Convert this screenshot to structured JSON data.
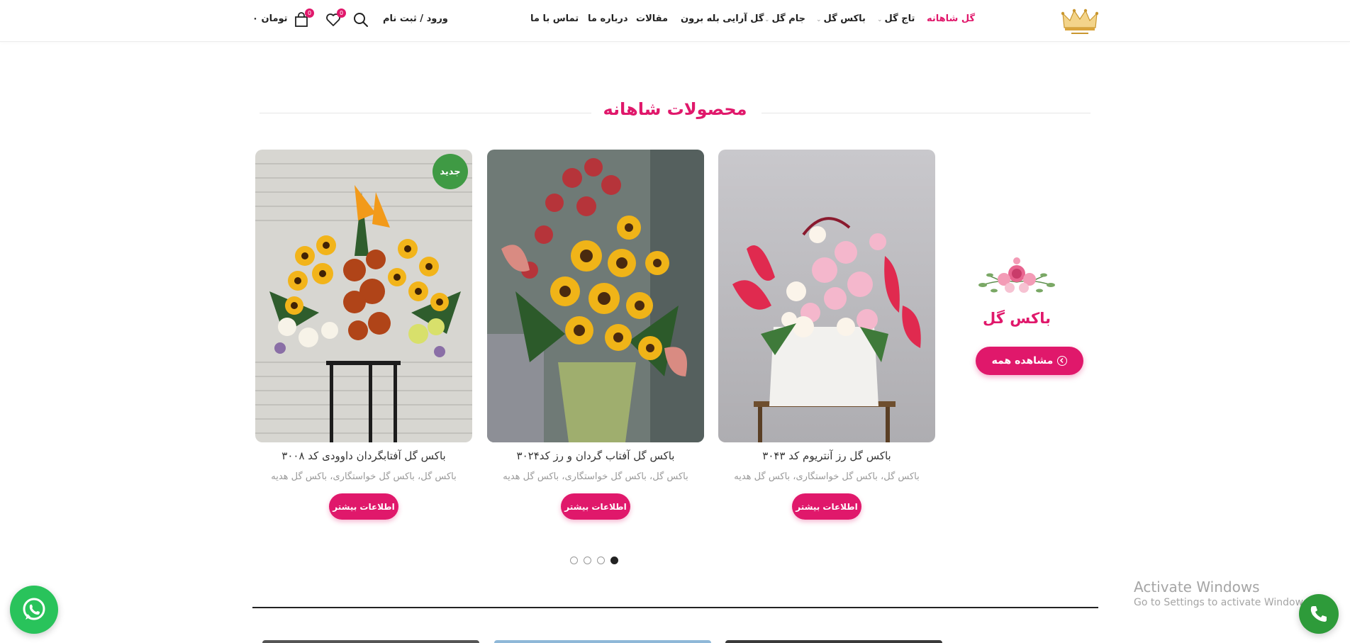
{
  "header": {
    "nav": [
      {
        "label": "گل شاهانه",
        "active": true,
        "dropdown": false
      },
      {
        "label": "تاج گل",
        "active": false,
        "dropdown": true
      },
      {
        "label": "باکس گل",
        "active": false,
        "dropdown": true
      },
      {
        "label": "جام گل",
        "active": false,
        "dropdown": true
      },
      {
        "label": "گل آرایی بله برون",
        "active": false,
        "dropdown": false
      },
      {
        "label": "مقالات",
        "active": false,
        "dropdown": false
      },
      {
        "label": "درباره ما",
        "active": false,
        "dropdown": false
      },
      {
        "label": "تماس با ما",
        "active": false,
        "dropdown": false
      }
    ],
    "login_label": "ورود / ثبت نام",
    "wishlist_count": "0",
    "cart_count": "0",
    "cart_total": "۰ تومان",
    "icons": {
      "search": "search-icon",
      "wishlist": "heart-icon",
      "cart": "shopping-bag-icon"
    }
  },
  "section": {
    "title": "محصولات شاهانه"
  },
  "promo": {
    "title": "باکس گل",
    "button_label": "مشاهده همه"
  },
  "products": [
    {
      "name": "باکس گل رز آنتریوم کد ۳۰۴۳",
      "categories": "باکس گل، باکس گل خواستگاری، باکس گل هدیه",
      "button_label": "اطلاعات بیشتر",
      "badge": ""
    },
    {
      "name": "باکس گل آفتاب گردان و رز کد۳۰۲۴",
      "categories": "باکس گل، باکس گل خواستگاری، باکس گل هدیه",
      "button_label": "اطلاعات بیشتر",
      "badge": ""
    },
    {
      "name": "باکس گل آفتابگردان داوودی کد ۳۰۰۸",
      "categories": "باکس گل، باکس گل خواستگاری، باکس گل هدیه",
      "button_label": "اطلاعات بیشتر",
      "badge": "جدید"
    }
  ],
  "carousel": {
    "page_count": 4,
    "active_page": 1
  },
  "watermark": {
    "line1": "Activate Windows",
    "line2": "Go to Settings to activate Windows."
  },
  "colors": {
    "accent": "#e0186b",
    "new_badge": "#3f9a44",
    "whatsapp": "#29c35b",
    "phone": "#2e9b3a"
  }
}
